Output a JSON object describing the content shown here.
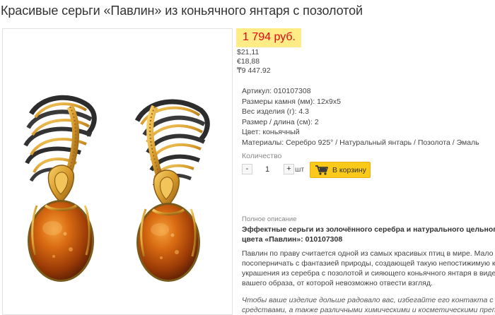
{
  "product": {
    "title": "Красивые серьги «Павлин» из коньячного янтаря с позолотой"
  },
  "price": {
    "main": "1 794 руб.",
    "usd": "$21,11",
    "eur": "€18,88",
    "kzt": "₸9 447.92",
    "highlight_color": "#ffec86",
    "price_color": "#e30613"
  },
  "specs": [
    {
      "label": "Артикул:",
      "value": "010107308"
    },
    {
      "label": "Размеры камня (мм):",
      "value": "12х9х5"
    },
    {
      "label": "Вес изделия (г):",
      "value": "4.3"
    },
    {
      "label": "Размер / длина (см):",
      "value": "2"
    },
    {
      "label": "Цвет:",
      "value": "коньячный"
    },
    {
      "label": "Материалы:",
      "value": "Серебро 925° / Натуральный янтарь / Позолота / Эмаль"
    }
  ],
  "quantity": {
    "label": "Количество",
    "minus": "-",
    "value": "1",
    "plus": "+",
    "unit": "шт"
  },
  "cart": {
    "button_label": "В корзину",
    "icon": "cart-icon",
    "button_color": "#fbc91a"
  },
  "description": {
    "label": "Полное описание",
    "heading_line1": "Эффектные серьги из золочённого серебра и натурального цельного янт",
    "heading_line2": "цвета «Павлин»: 010107308",
    "p1_line1": "Павлин по праву считается одной из самых красивых птиц в мире. Мало",
    "p1_line2": "посоперничать с фантазией природы, создающей такую непостижимую красот",
    "p1_line3": "украшения из серебра с позолотой и сияющего коньячного янтаря в виде пера",
    "p1_line4": "вашего образа, от которой невозможно отвести взгляд.",
    "p2_line1": "Чтобы ваше изделие дольше радовало вас, избегайте его контакта с абраз",
    "p2_line2": "средствами, а также различными химическими и косметическими препарат"
  }
}
